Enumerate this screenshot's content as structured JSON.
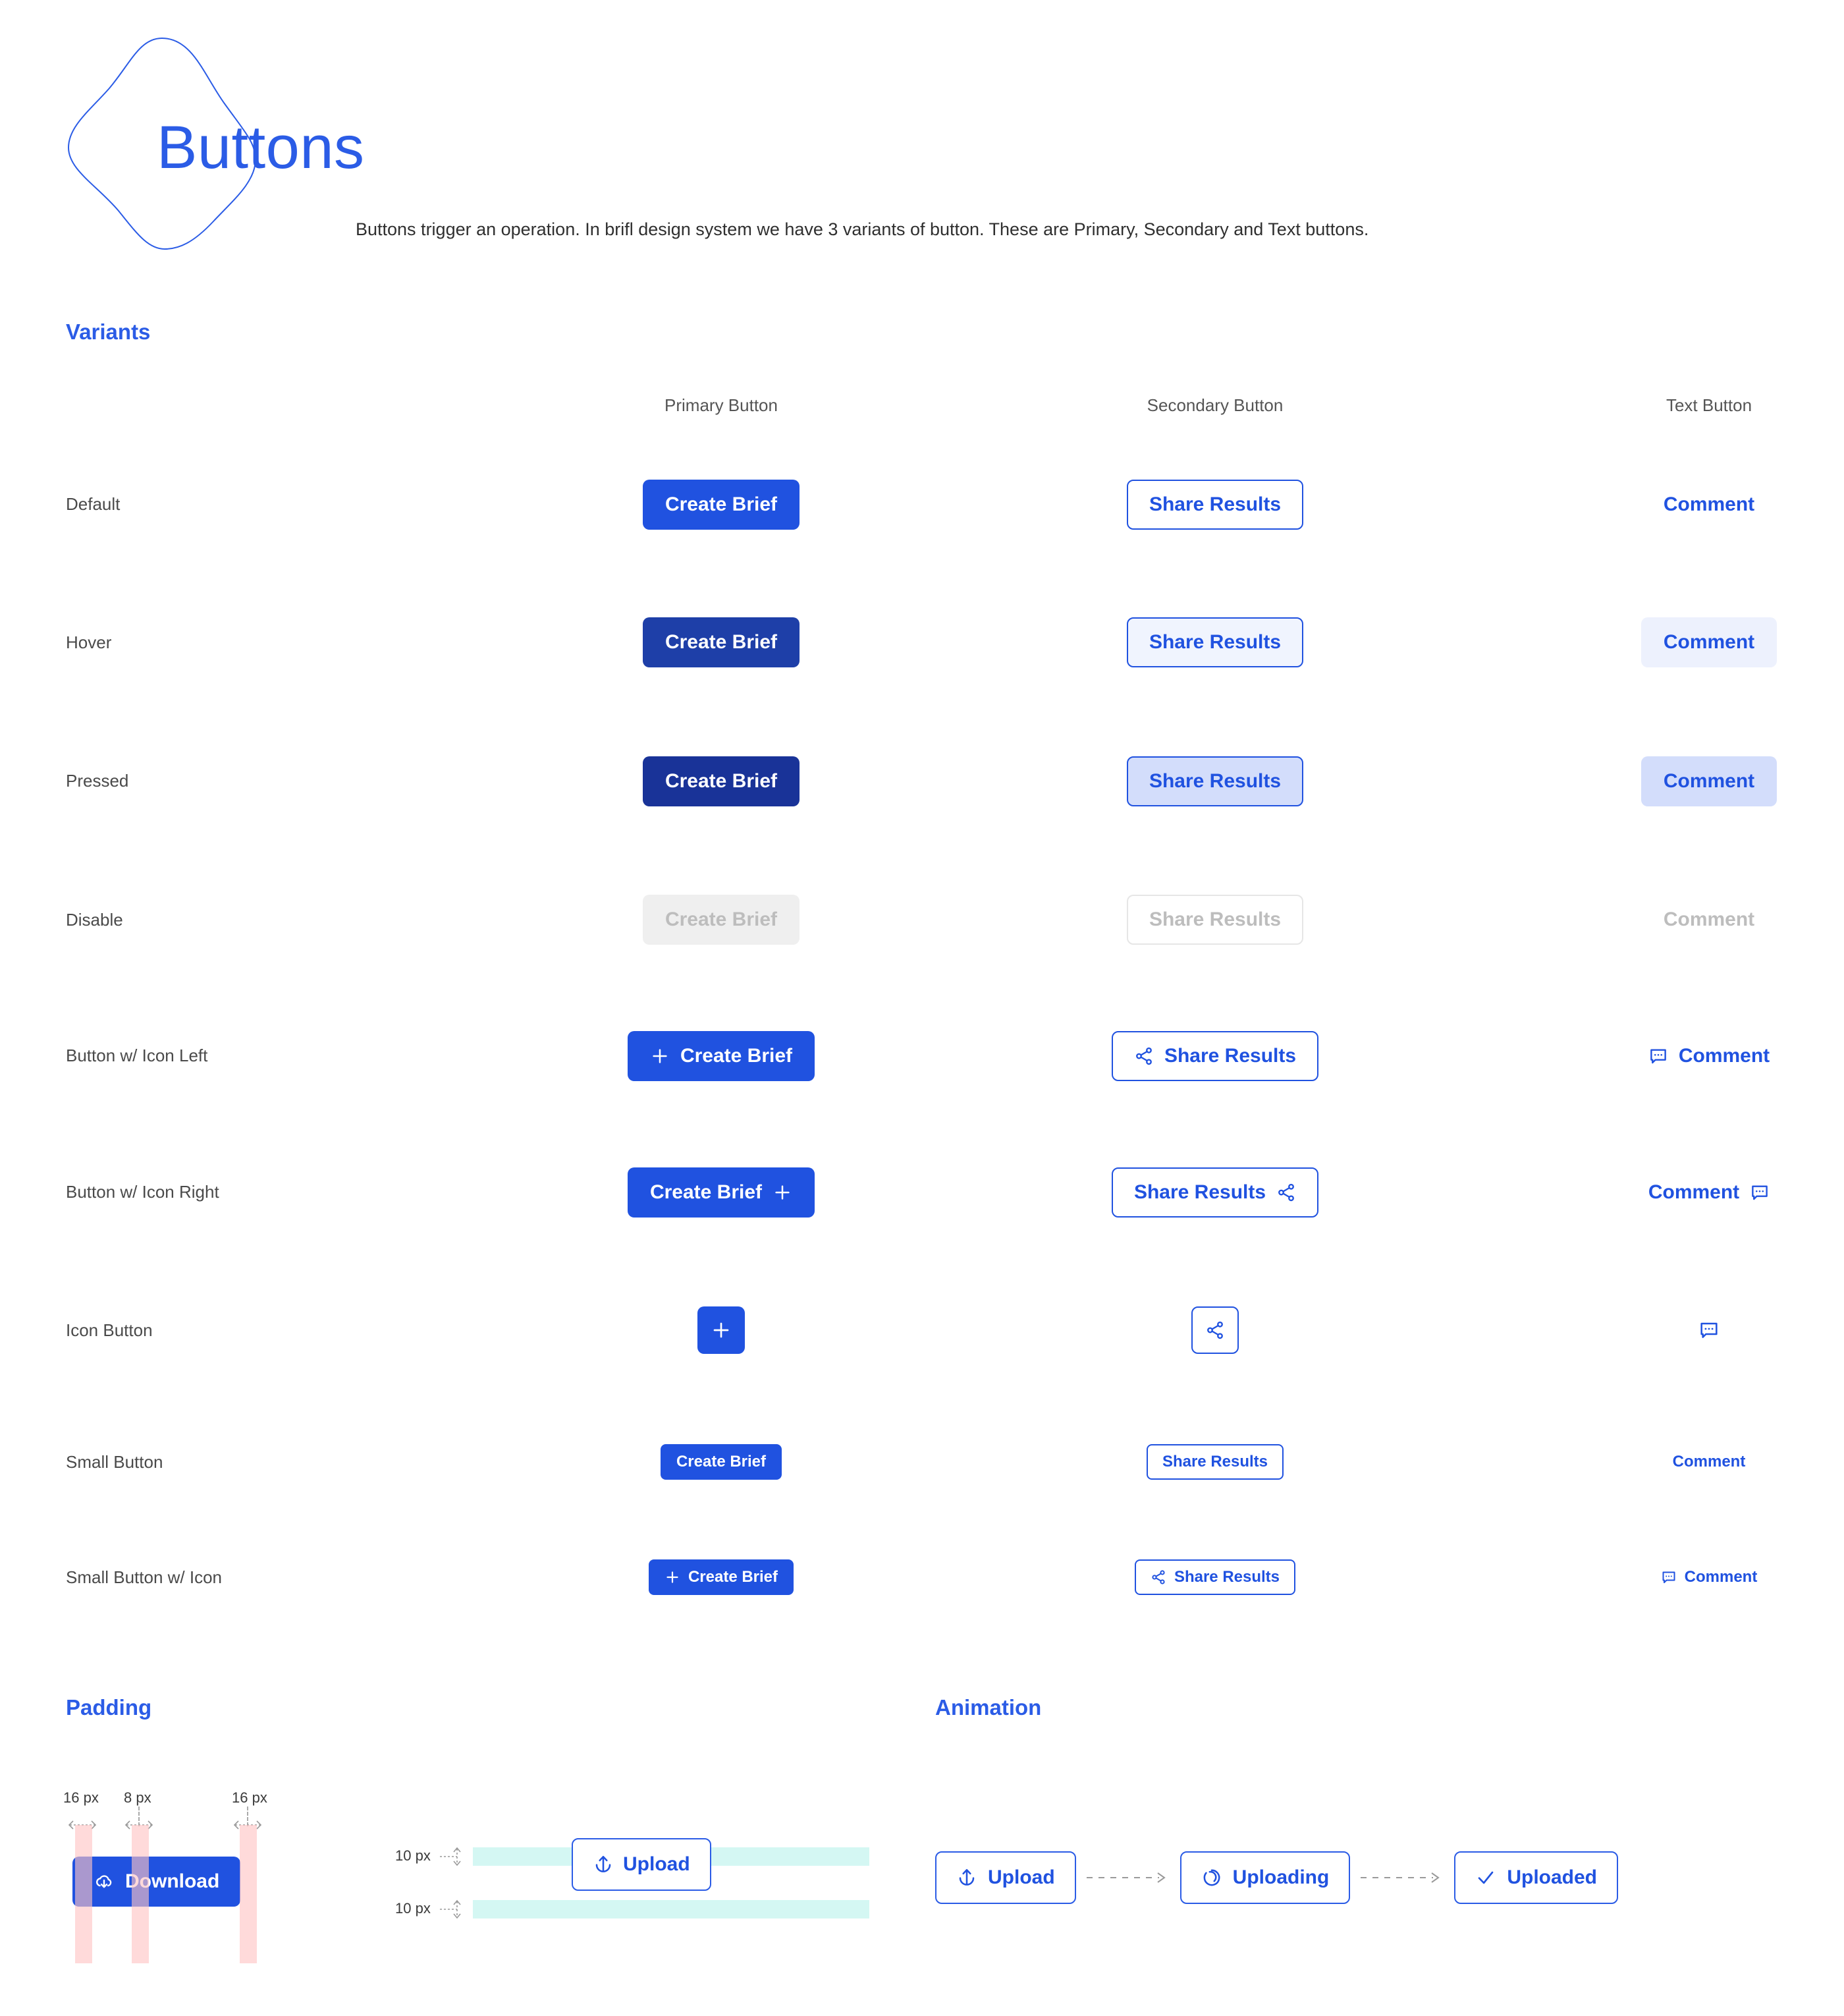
{
  "header": {
    "title": "Buttons",
    "description": "Buttons trigger an operation. In brifl design system we have 3 variants of button. These are Primary, Secondary and Text buttons.",
    "logo_icon": "blob-shape-icon"
  },
  "sections": {
    "variants": "Variants",
    "padding": "Padding",
    "animation": "Animation"
  },
  "columns": {
    "primary": "Primary Button",
    "secondary": "Secondary Button",
    "text": "Text Button"
  },
  "labels": {
    "primary": "Create Brief",
    "secondary": "Share Results",
    "text": "Comment"
  },
  "rows": {
    "default": "Default",
    "hover": "Hover",
    "pressed": "Pressed",
    "disable": "Disable",
    "icon_left": "Button w/ Icon Left",
    "icon_right": "Button w/ Icon Right",
    "icon_button": "Icon Button",
    "small": "Small Button",
    "small_icon": "Small Button w/ Icon"
  },
  "icons": {
    "primary": "plus-icon",
    "secondary": "share-icon",
    "text": "comment-icon",
    "download": "cloud-download-icon",
    "upload": "upload-arrow-icon",
    "uploading": "spinner-icon",
    "uploaded": "check-icon"
  },
  "padding": {
    "left": "16 px",
    "gap": "8 px",
    "right": "16 px",
    "top": "10 px",
    "bottom": "10 px",
    "button_label": "Download",
    "vertical_button_label": "Upload"
  },
  "animation": {
    "steps": [
      {
        "label": "Upload",
        "icon": "upload-arrow-icon"
      },
      {
        "label": "Uploading",
        "icon": "spinner-icon"
      },
      {
        "label": "Uploaded",
        "icon": "check-icon"
      }
    ]
  },
  "colors": {
    "primary": "#2052E0",
    "primary_hover": "#1E3FA8",
    "primary_pressed": "#193398",
    "disabled_bg": "#EFEFEF",
    "disabled_text": "#BDBDBD",
    "secondary_hover_bg": "#F0F4FE",
    "pressed_tint": "#D3DDFB",
    "guide_pink": "#FFC3C3",
    "guide_cyan": "#D4F7F3"
  }
}
